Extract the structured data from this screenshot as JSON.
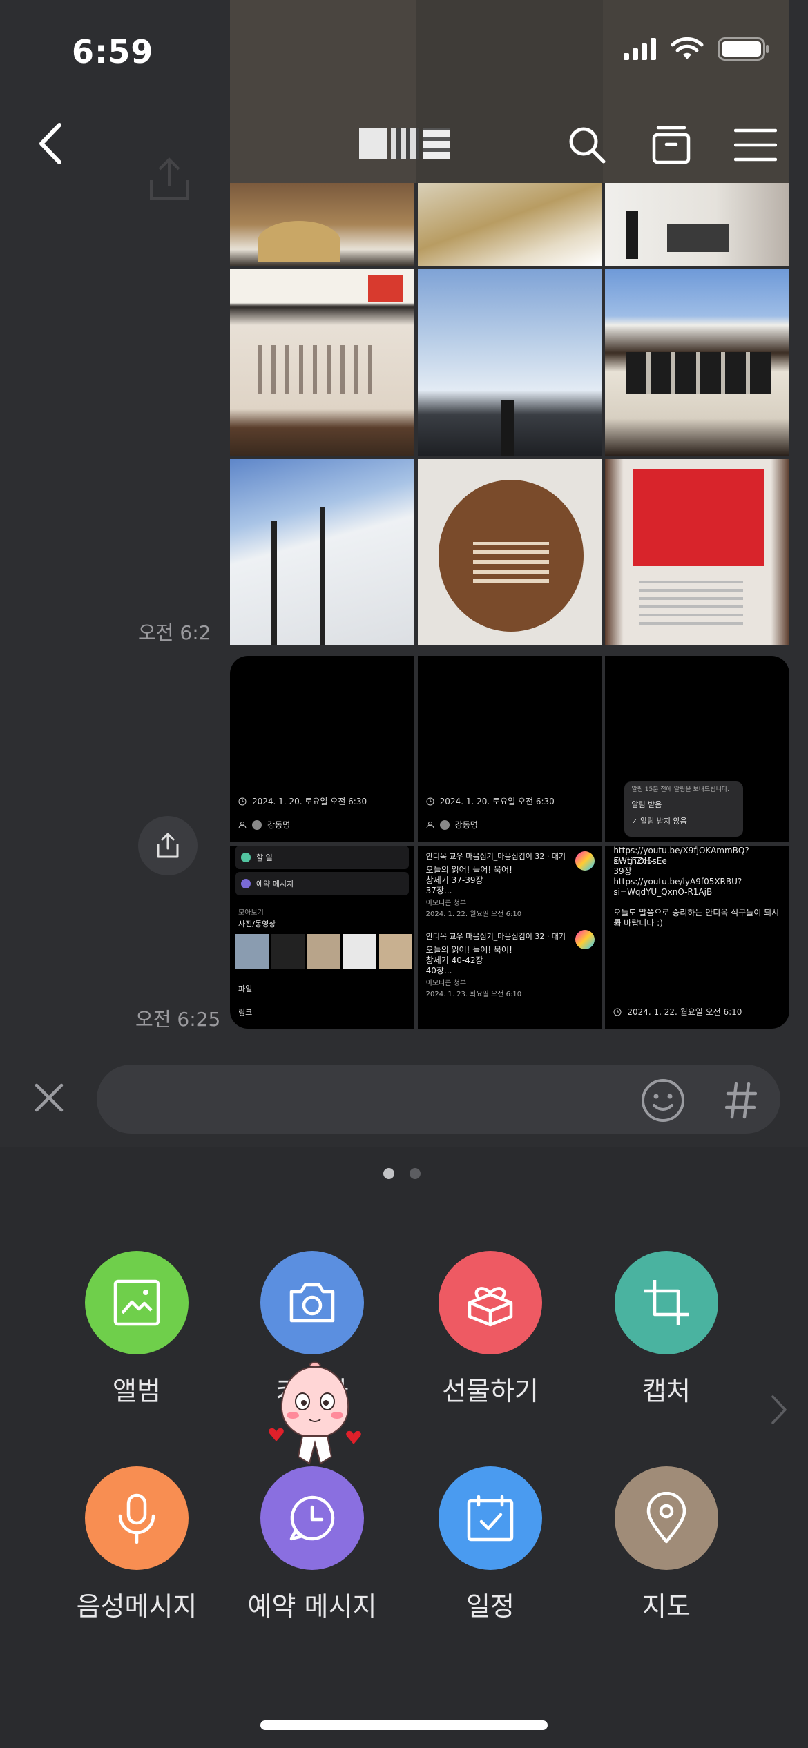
{
  "status_bar": {
    "time": "6:59"
  },
  "nav": {
    "title": ""
  },
  "messages": {
    "timestamp_1": "오전 6:2",
    "timestamp_2": "오전 6:25"
  },
  "shots": {
    "s1": {
      "date": "2024. 1. 20. 토요일  오전 6:30",
      "user": "강동명"
    },
    "s2": {
      "date": "2024. 1. 20. 토요일  오전 6:30",
      "user": "강동명"
    },
    "s3": {
      "popup_title": "알림 15분 전에 알림을 보내드립니다.",
      "opt1": "알림 받음",
      "opt2": "✓ 알림 받지 않음"
    },
    "s4": {
      "row1": "할 일",
      "row2": "예약 메시지",
      "section": "모아보기",
      "sub": "사진/동영상",
      "item1": "파일",
      "item2": "링크"
    },
    "s5": {
      "title1": "안디옥 교우 마음심기_마음심김이 32 · 대기",
      "body1a": "오늘의 읽어! 들어! 묵어!",
      "body1b": "창세기 37-39장",
      "body1c": "37장...",
      "sender1": "이모니콘 청부",
      "date1": "2024. 1. 22. 월요일 오전 6:10",
      "title2": "안디옥 교우 마음심기_마음심김이 32 · 대기",
      "body2a": "오늘의 읽어! 들어! 묵어!",
      "body2b": "창세기 40-42장",
      "body2c": "40장...",
      "sender2": "이모티콘 청부",
      "date2": "2024. 1. 23. 화요일 오전 6:10"
    },
    "s6": {
      "l1": "https://youtu.be/X9fjOKAmmBQ?si=tjTOH-",
      "l2": "EWLhZc5sEe",
      "l3": "39장",
      "l4": "https://youtu.be/lyA9f05XRBU?",
      "l5": "si=WqdYU_QxnO-R1AjB",
      "l6": "오늘도 말씀으로 승리하는 안디옥 식구들이 되시기",
      "l7": "를 바랍니다 :)",
      "date": "2024. 1. 22. 월요일  오전 6:10"
    }
  },
  "input": {
    "placeholder": ""
  },
  "panel": {
    "items": [
      {
        "label": "앨범",
        "color": "#6fcf4b",
        "icon": "album-icon"
      },
      {
        "label": "카메라",
        "color": "#5b8fe0",
        "icon": "camera-icon"
      },
      {
        "label": "선물하기",
        "color": "#ee5a63",
        "icon": "gift-icon"
      },
      {
        "label": "캡처",
        "color": "#4ab3a0",
        "icon": "crop-icon"
      },
      {
        "label": "음성메시지",
        "color": "#f88e52",
        "icon": "microphone-icon"
      },
      {
        "label": "예약 메시지",
        "color": "#8a6fe0",
        "icon": "clock-message-icon"
      },
      {
        "label": "일정",
        "color": "#4a9bf0",
        "icon": "calendar-icon"
      },
      {
        "label": "지도",
        "color": "#a08c78",
        "icon": "map-pin-icon"
      }
    ]
  }
}
